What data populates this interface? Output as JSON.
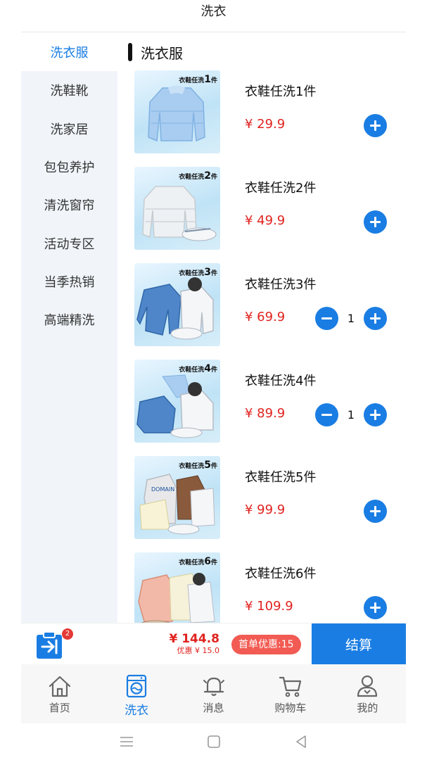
{
  "header": {
    "title": "洗衣"
  },
  "sidebar": {
    "items": [
      {
        "label": "洗衣服",
        "active": true
      },
      {
        "label": "洗鞋靴"
      },
      {
        "label": "洗家居"
      },
      {
        "label": "包包养护"
      },
      {
        "label": "清洗窗帘"
      },
      {
        "label": "活动专区"
      },
      {
        "label": "当季热销"
      },
      {
        "label": "高端精洗"
      }
    ]
  },
  "section": {
    "title": "洗衣服"
  },
  "products": [
    {
      "name": "衣鞋任洗1件",
      "price": "¥ 29.9",
      "tag_prefix": "衣鞋任洗",
      "tag_num": "1",
      "tag_suffix": "件",
      "quantity": null
    },
    {
      "name": "衣鞋任洗2件",
      "price": "¥ 49.9",
      "tag_prefix": "衣鞋任洗",
      "tag_num": "2",
      "tag_suffix": "件",
      "quantity": null
    },
    {
      "name": "衣鞋任洗3件",
      "price": "¥ 69.9",
      "tag_prefix": "衣鞋任洗",
      "tag_num": "3",
      "tag_suffix": "件",
      "quantity": "1"
    },
    {
      "name": "衣鞋任洗4件",
      "price": "¥ 89.9",
      "tag_prefix": "衣鞋任洗",
      "tag_num": "4",
      "tag_suffix": "件",
      "quantity": "1"
    },
    {
      "name": "衣鞋任洗5件",
      "price": "¥ 99.9",
      "tag_prefix": "衣鞋任洗",
      "tag_num": "5",
      "tag_suffix": "件",
      "quantity": null
    },
    {
      "name": "衣鞋任洗6件",
      "price": "¥ 109.9",
      "tag_prefix": "衣鞋任洗",
      "tag_num": "6",
      "tag_suffix": "件",
      "quantity": null
    }
  ],
  "cart": {
    "badge_count": "2",
    "total": "¥ 144.8",
    "discount": "优惠 ¥ 15.0",
    "promo": "首单优惠:15",
    "checkout_label": "结算"
  },
  "tabs": [
    {
      "label": "首页",
      "icon": "home-icon"
    },
    {
      "label": "洗衣",
      "icon": "washing-machine-icon",
      "active": true
    },
    {
      "label": "消息",
      "icon": "bell-icon"
    },
    {
      "label": "购物车",
      "icon": "cart-icon"
    },
    {
      "label": "我的",
      "icon": "user-icon"
    }
  ],
  "colors": {
    "accent": "#1a7de3",
    "price": "#e0231f",
    "promo": "#f25b53",
    "sidebar_bg": "#f1f5fa"
  }
}
